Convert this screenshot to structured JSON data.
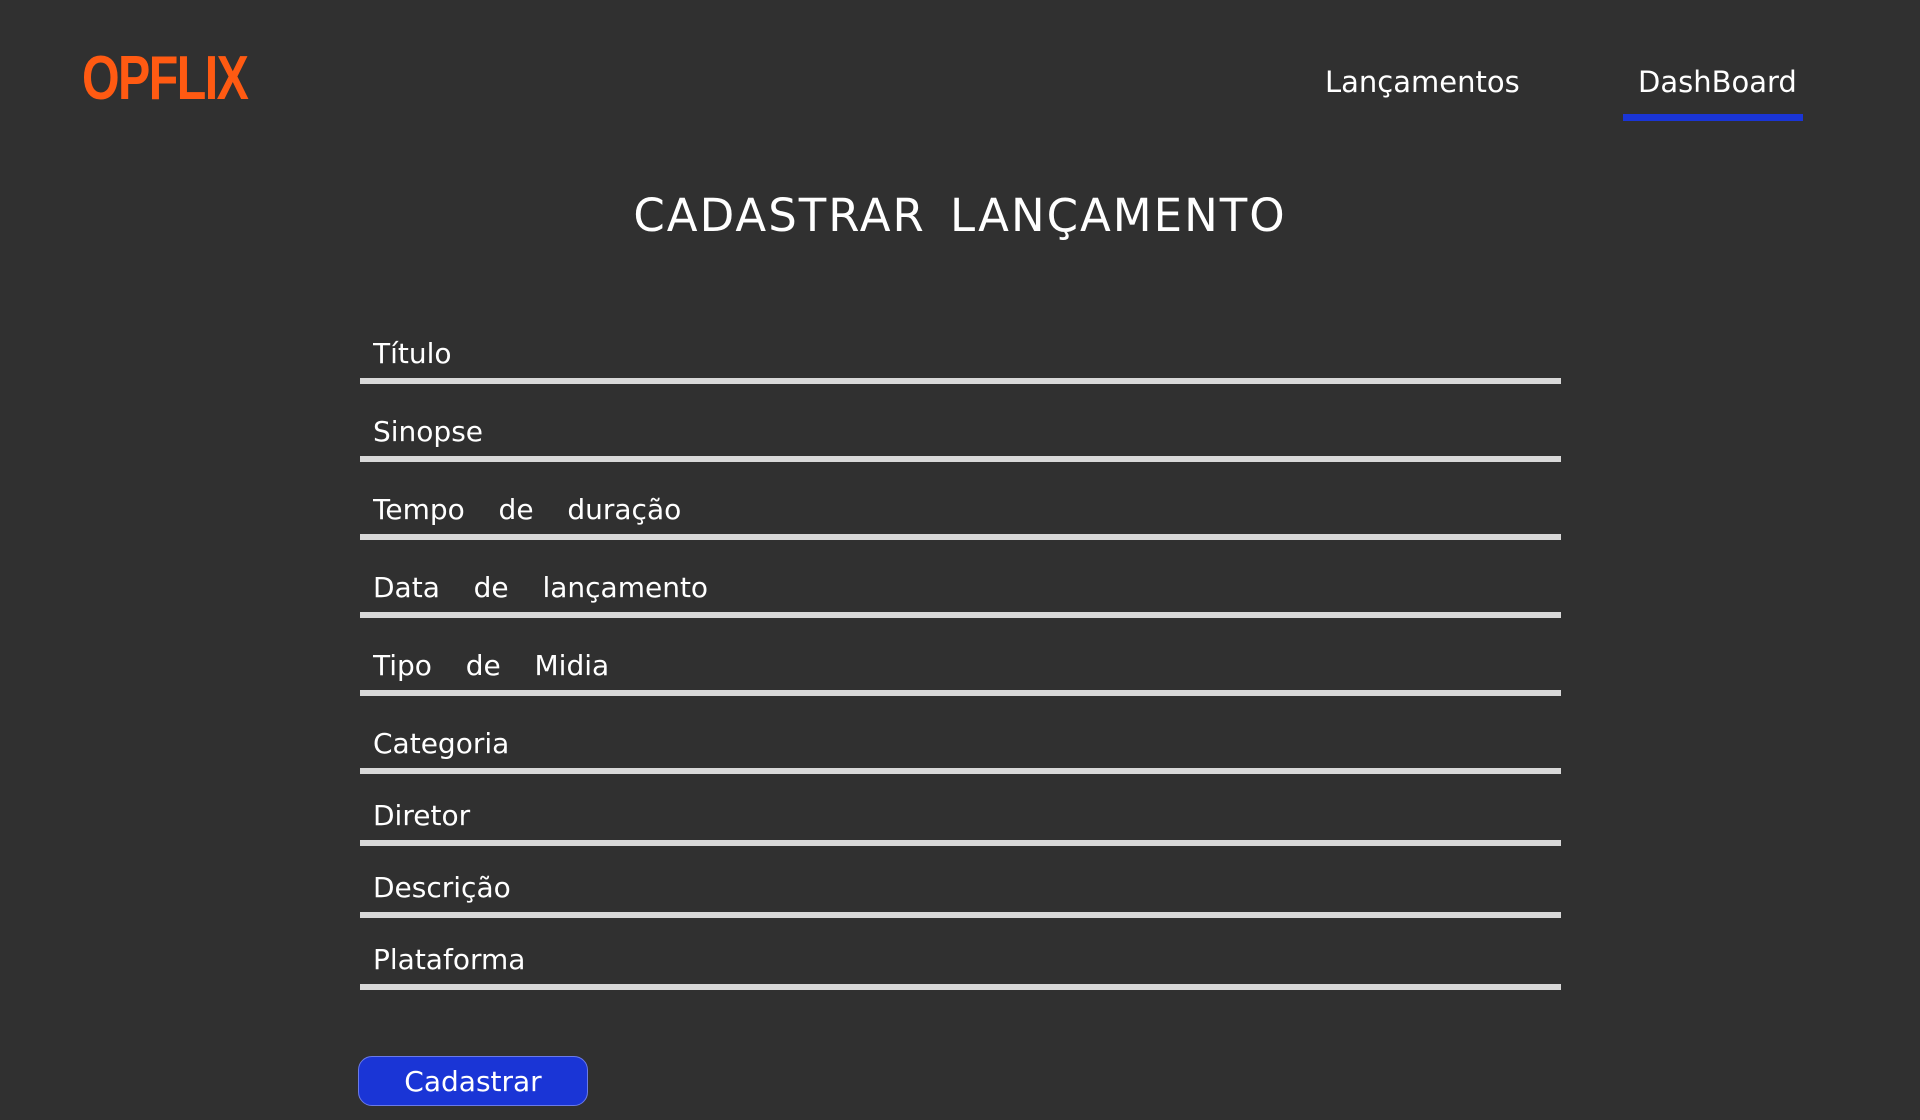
{
  "header": {
    "logo": "OPFLIX",
    "nav": [
      {
        "label": "Lançamentos"
      },
      {
        "label": "DashBoard",
        "active": true
      }
    ],
    "active_color": "#1a35d6"
  },
  "page": {
    "title": "CADASTRAR  LANÇAMENTO"
  },
  "form": {
    "fields": [
      {
        "placeholder": "Título",
        "value": ""
      },
      {
        "placeholder": "Sinopse",
        "value": ""
      },
      {
        "placeholder": "Tempo  de  duração",
        "value": ""
      },
      {
        "placeholder": "Data  de  lançamento",
        "value": ""
      },
      {
        "placeholder": "Tipo  de  Midia",
        "value": ""
      },
      {
        "placeholder": "Categoria",
        "value": ""
      },
      {
        "placeholder": "Diretor",
        "value": ""
      },
      {
        "placeholder": "Descrição",
        "value": ""
      },
      {
        "placeholder": "Plataforma",
        "value": ""
      }
    ],
    "submit_label": "Cadastrar"
  },
  "colors": {
    "background": "#303030",
    "logo": "#ff5a12",
    "accent": "#1a35d6",
    "field_line": "#d8d8d8"
  }
}
